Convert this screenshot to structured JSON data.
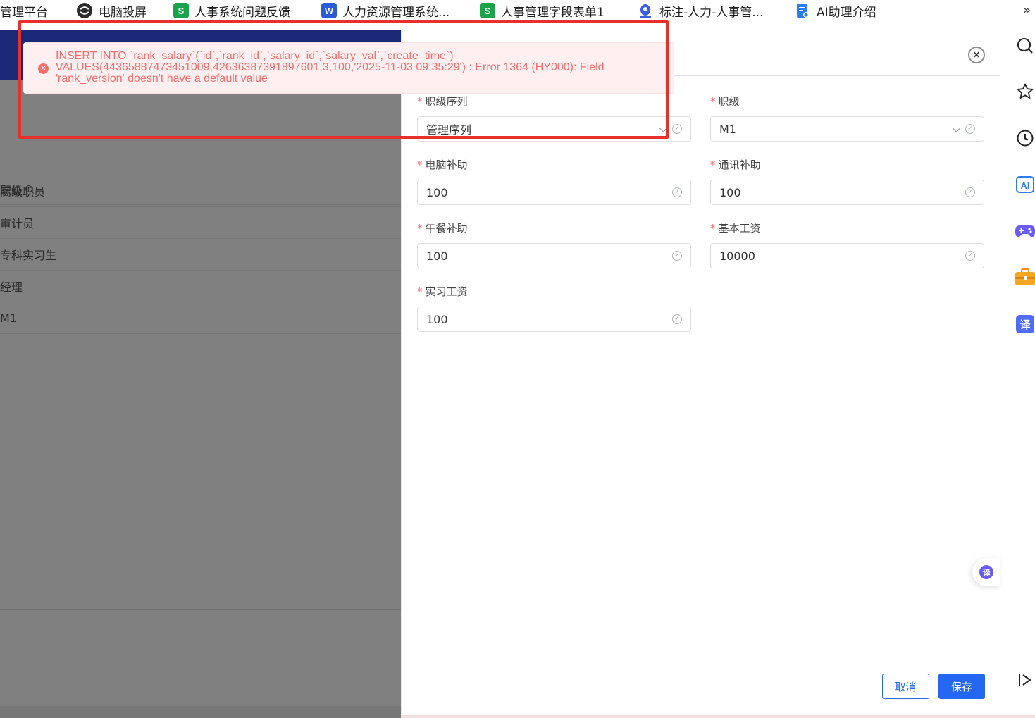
{
  "bookmarks": [
    {
      "label": "管理平台",
      "icon": "partial-icon"
    },
    {
      "label": "电脑投屏",
      "icon": "screencast-icon"
    },
    {
      "label": "人事系统问题反馈",
      "icon": "sheet-icon",
      "icon_text": "S"
    },
    {
      "label": "人力资源管理系统...",
      "icon": "word-icon",
      "icon_text": "W"
    },
    {
      "label": "人事管理字段表单1",
      "icon": "sheet-icon",
      "icon_text": "S"
    },
    {
      "label": "标注-人力-人事管...",
      "icon": "annotation-icon"
    },
    {
      "label": "AI助理介绍",
      "icon": "doc-icon"
    }
  ],
  "bookmarks_more": "»",
  "left_table": {
    "header": "职级",
    "rows": [
      "高级职员",
      "审计员",
      "专科实习生",
      "经理",
      "M1"
    ]
  },
  "error": {
    "line1": "INSERT INTO `rank_salary`(`id`,`rank_id`,`salary_id`,`salary_val`,`create_time`)",
    "line2": "VALUES(443658874734510​09,426363873918976​01,3,100,'2025-11-03 09:35:29') : Error 1364 (HY000): Field",
    "line3": "'rank_version' doesn't have a default value"
  },
  "form": {
    "rank_sequence": {
      "label": "职级序列",
      "value": "管理序列"
    },
    "rank": {
      "label": "职级",
      "value": "M1"
    },
    "computer_allowance": {
      "label": "电脑补助",
      "value": "100"
    },
    "comm_allowance": {
      "label": "通讯补助",
      "value": "100"
    },
    "lunch_allowance": {
      "label": "午餐补助",
      "value": "100"
    },
    "base_salary": {
      "label": "基本工资",
      "value": "10000"
    },
    "intern_salary": {
      "label": "实习工资",
      "value": "100"
    }
  },
  "required_mark": "*",
  "buttons": {
    "cancel": "取消",
    "save": "保存"
  },
  "colors": {
    "primary": "#2468f2",
    "error": "#f56c6c",
    "banner": "#1b2a78"
  }
}
